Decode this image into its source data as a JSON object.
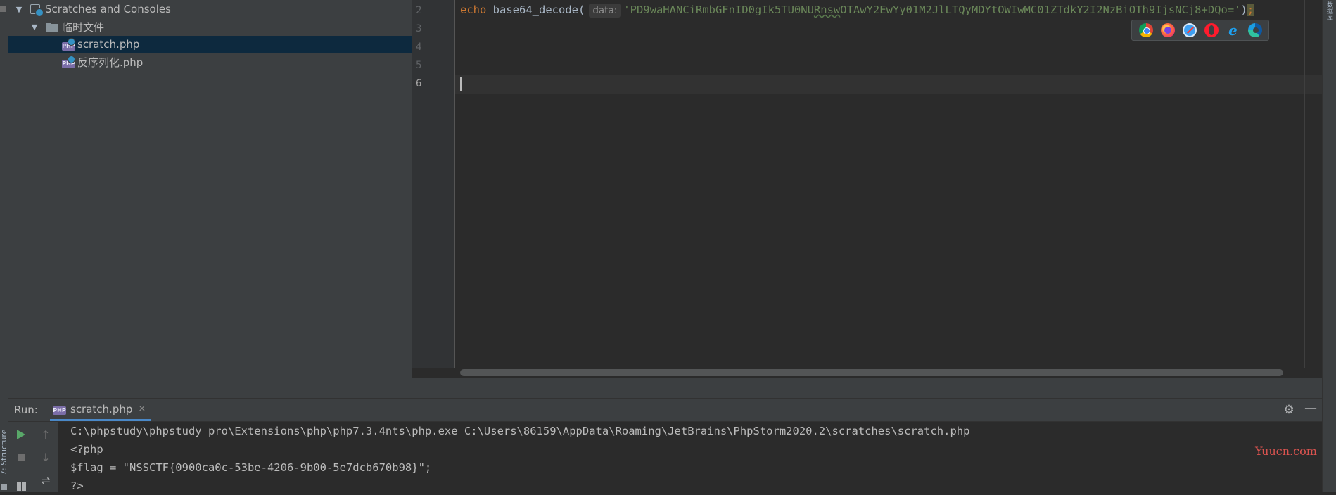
{
  "project_tree": {
    "root_label": "Scratches and Consoles",
    "folder_label": "临时文件",
    "files": [
      {
        "label": "scratch.php",
        "icon_text": "PHP"
      },
      {
        "label": "反序列化.php",
        "icon_text": "PHP"
      }
    ]
  },
  "editor": {
    "line_numbers": [
      "2",
      "3",
      "4",
      "5",
      "6"
    ],
    "code": {
      "keyword": "echo",
      "function": "base64_decode(",
      "hint": "data:",
      "string_part1": "'PD9waHANCiRmbGFnID0gIk5TU0NU",
      "string_typo": "Rnsw",
      "string_part2": "OTAwY2EwYy01M2JlLTQyMDYtOWIwMC01ZTdkY2I2NzBiOTh9IjsNCj8+DQo='",
      "close": ")",
      "semicolon": ";"
    }
  },
  "browser_popup": {
    "icons": [
      "chrome-icon",
      "firefox-icon",
      "safari-icon",
      "opera-icon",
      "ie-icon",
      "edge-icon"
    ],
    "ie_glyph": "e"
  },
  "right_stripe": {
    "tab_label": "数据库"
  },
  "left_stripe": {
    "structure_label": "7: Structure"
  },
  "run_panel": {
    "label": "Run:",
    "tab_label": "scratch.php",
    "tab_icon_text": "PHP",
    "close_glyph": "×",
    "gear_glyph": "⚙",
    "minimize_glyph": "—",
    "output": [
      "C:\\phpstudy\\phpstudy_pro\\Extensions\\php\\php7.3.4nts\\php.exe C:\\Users\\86159\\AppData\\Roaming\\JetBrains\\PhpStorm2020.2\\scratches\\scratch.php",
      "<?php",
      "$flag = \"NSSCTF{0900ca0c-53be-4206-9b00-5e7dcb670b98}\";",
      "?>"
    ]
  },
  "watermark": "Yuucn.com",
  "colors": {
    "keyword": "#cc7832",
    "string": "#6a8759",
    "selection": "#0d293e",
    "run_green": "#59a869"
  }
}
